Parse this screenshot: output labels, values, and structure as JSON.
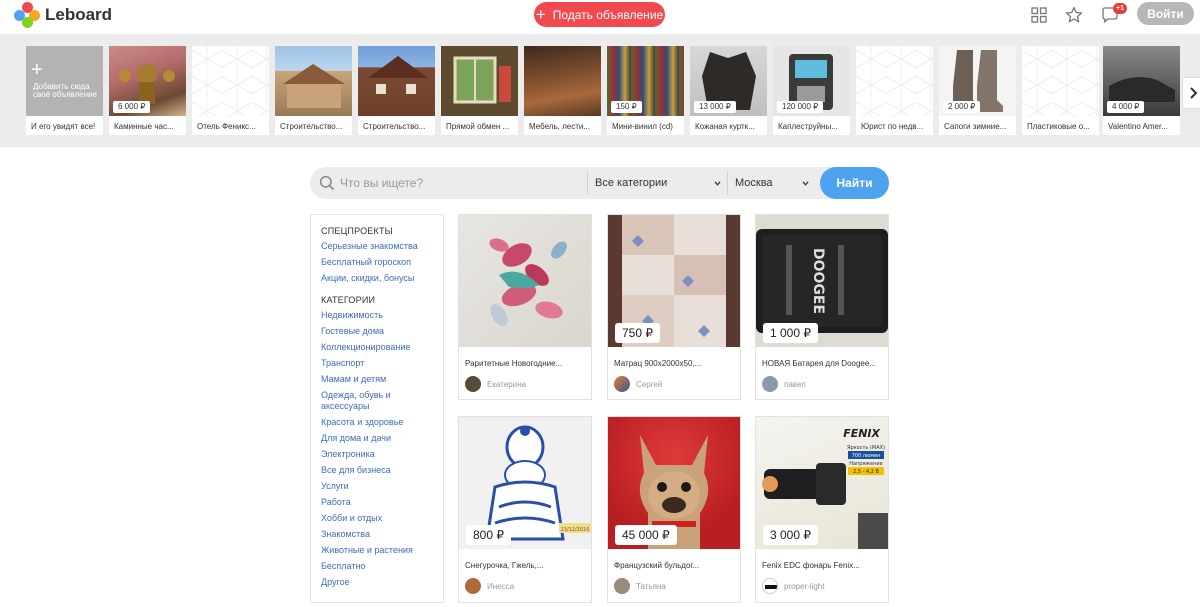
{
  "app": {
    "name": "Leboard"
  },
  "header": {
    "post_label": "Подать объявление",
    "messages_badge": "+1",
    "login_label": "Войти"
  },
  "strip": {
    "add_card_text": "Добавить сюда своё объявление",
    "add_card_caption": "И его увидят все!",
    "items": [
      {
        "caption": "Каминные час...",
        "price": "6 000 ₽"
      },
      {
        "caption": "Отель Феникс...",
        "price": ""
      },
      {
        "caption": "Строительство...",
        "price": ""
      },
      {
        "caption": "Строительство...",
        "price": ""
      },
      {
        "caption": "Прямой обмен ...",
        "price": ""
      },
      {
        "caption": "Мебель, лести...",
        "price": ""
      },
      {
        "caption": "Мини-винил (cd)",
        "price": "150 ₽"
      },
      {
        "caption": "Кожаная куртк...",
        "price": "13 000 ₽"
      },
      {
        "caption": "Каплеструйны...",
        "price": "120 000 ₽"
      },
      {
        "caption": "Юрист по недв...",
        "price": ""
      },
      {
        "caption": "Сапоги зимние...",
        "price": "2 000 ₽"
      },
      {
        "caption": "Пластиковые о...",
        "price": ""
      },
      {
        "caption": "Valentino Amer...",
        "price": "4 000 ₽"
      }
    ]
  },
  "search": {
    "placeholder": "Что вы ищете?",
    "category": "Все категории",
    "city": "Москва",
    "button": "Найти"
  },
  "sidebar": {
    "special_heading": "СПЕЦПРОЕКТЫ",
    "special": [
      "Серьезные знакомства",
      "Бесплатный гороскоп",
      "Акции, скидки, бонусы"
    ],
    "categories_heading": "КАТЕГОРИИ",
    "categories": [
      "Недвижимость",
      "Гостевые дома",
      "Коллекционирование",
      "Транспорт",
      "Мамам и детям",
      "Одежда, обувь и аксессуары",
      "Красота и здоровье",
      "Для дома и дачи",
      "Электроника",
      "Все для бизнеса",
      "Услуги",
      "Работа",
      "Хобби и отдых",
      "Знакомства",
      "Животные и растения",
      "Бесплатно",
      "Другое"
    ]
  },
  "products": [
    {
      "title": "Раритетные Новогодние...",
      "price": "",
      "seller": "Екатерина"
    },
    {
      "title": "Матрац 900х2000х50,...",
      "price": "750 ₽",
      "seller": "Сергей"
    },
    {
      "title": "НОВАЯ Батарея для Doogee...",
      "price": "1 000 ₽",
      "seller": "павел"
    },
    {
      "title": "Снегурочка, Гжель,...",
      "price": "800 ₽",
      "seller": "Инесса"
    },
    {
      "title": "Французский бульдог...",
      "price": "45 000 ₽",
      "seller": "Татьяна"
    },
    {
      "title": "Fenix EDC фонарь Fenix...",
      "price": "3 000 ₽",
      "seller": "proper-light"
    }
  ],
  "photo_text": {
    "battery_brand": "DOOGEE",
    "fenix_brand": "FENIX",
    "fenix_line1": "Яркость (MAX)",
    "fenix_line2": "700 люмен",
    "fenix_line3": "Напряжение",
    "fenix_line4": "2,5 - 4,2 В",
    "snow_date": "23/12/2016"
  }
}
